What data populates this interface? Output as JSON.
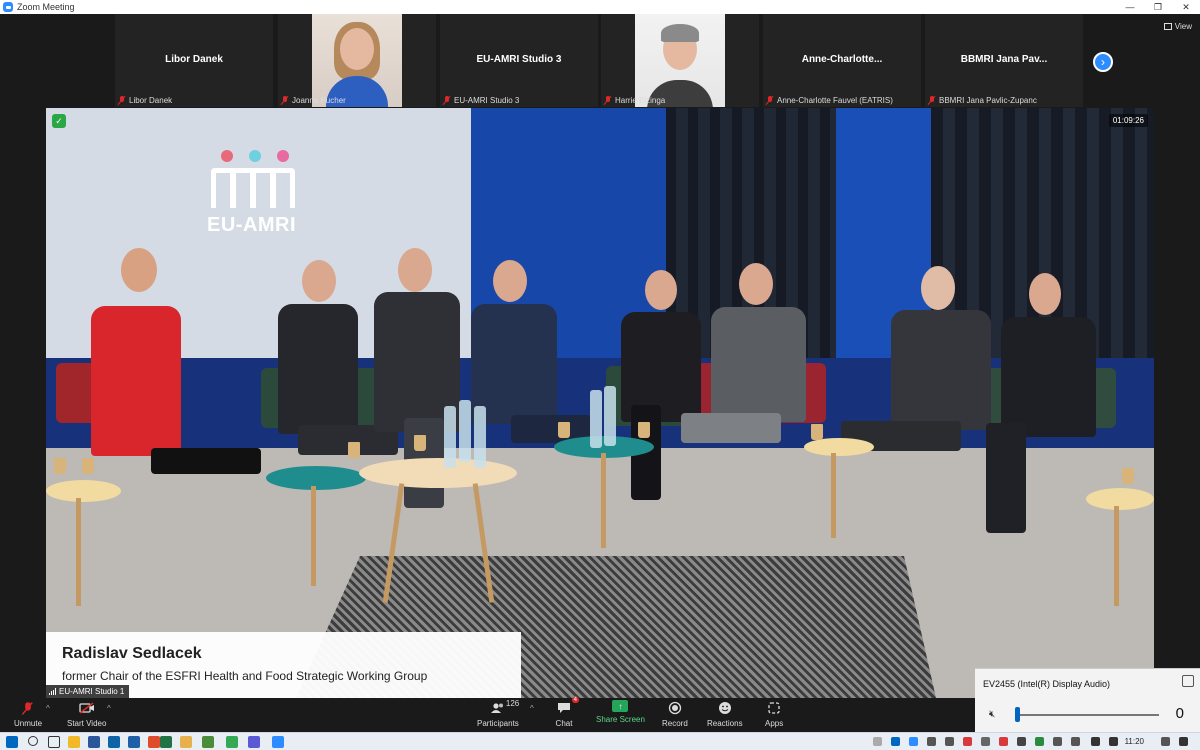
{
  "window": {
    "title": "Zoom Meeting",
    "controls": [
      "—",
      "❐",
      "✕"
    ]
  },
  "gallery": {
    "tiles": [
      {
        "display": "Libor Danek",
        "footer": "Libor Danek",
        "type": "name"
      },
      {
        "display": "",
        "footer": "Joanna Pucher",
        "type": "woman"
      },
      {
        "display": "EU-AMRI Studio 3",
        "footer": "EU-AMRI Studio 3",
        "type": "name"
      },
      {
        "display": "",
        "footer": "Harrie Elzinga",
        "type": "man"
      },
      {
        "display": "Anne-Charlotte...",
        "footer": "Anne-Charlotte Fauvel (EATRIS)",
        "type": "name"
      },
      {
        "display": "BBMRI Jana Pav...",
        "footer": "BBMRI Jana Pavlic-Zupanc",
        "type": "name"
      }
    ],
    "view_label": "View",
    "next_icon": "›"
  },
  "video": {
    "logo_text": "EU-AMRI",
    "logo_dot_colors": [
      "#e86a7a",
      "#6fd0e0",
      "#e86aa0"
    ],
    "timer": "01:09:26",
    "lower_third": {
      "name": "Radislav Sedlacek",
      "role": "former Chair of the ESFRI Health and Food Strategic Working Group"
    },
    "speaker_label": "EU-AMRI Studio 1"
  },
  "toolbar": {
    "unmute": "Unmute",
    "start_video": "Start Video",
    "participants": "Participants",
    "participants_count": "126",
    "chat": "Chat",
    "chat_badge": "4",
    "share_screen": "Share Screen",
    "record": "Record",
    "reactions": "Reactions",
    "apps": "Apps"
  },
  "audio_popup": {
    "device": "EV2455 (Intel(R) Display Audio)",
    "volume": "0",
    "volume_level": 0
  },
  "taskbar": {
    "time": "11:20"
  }
}
